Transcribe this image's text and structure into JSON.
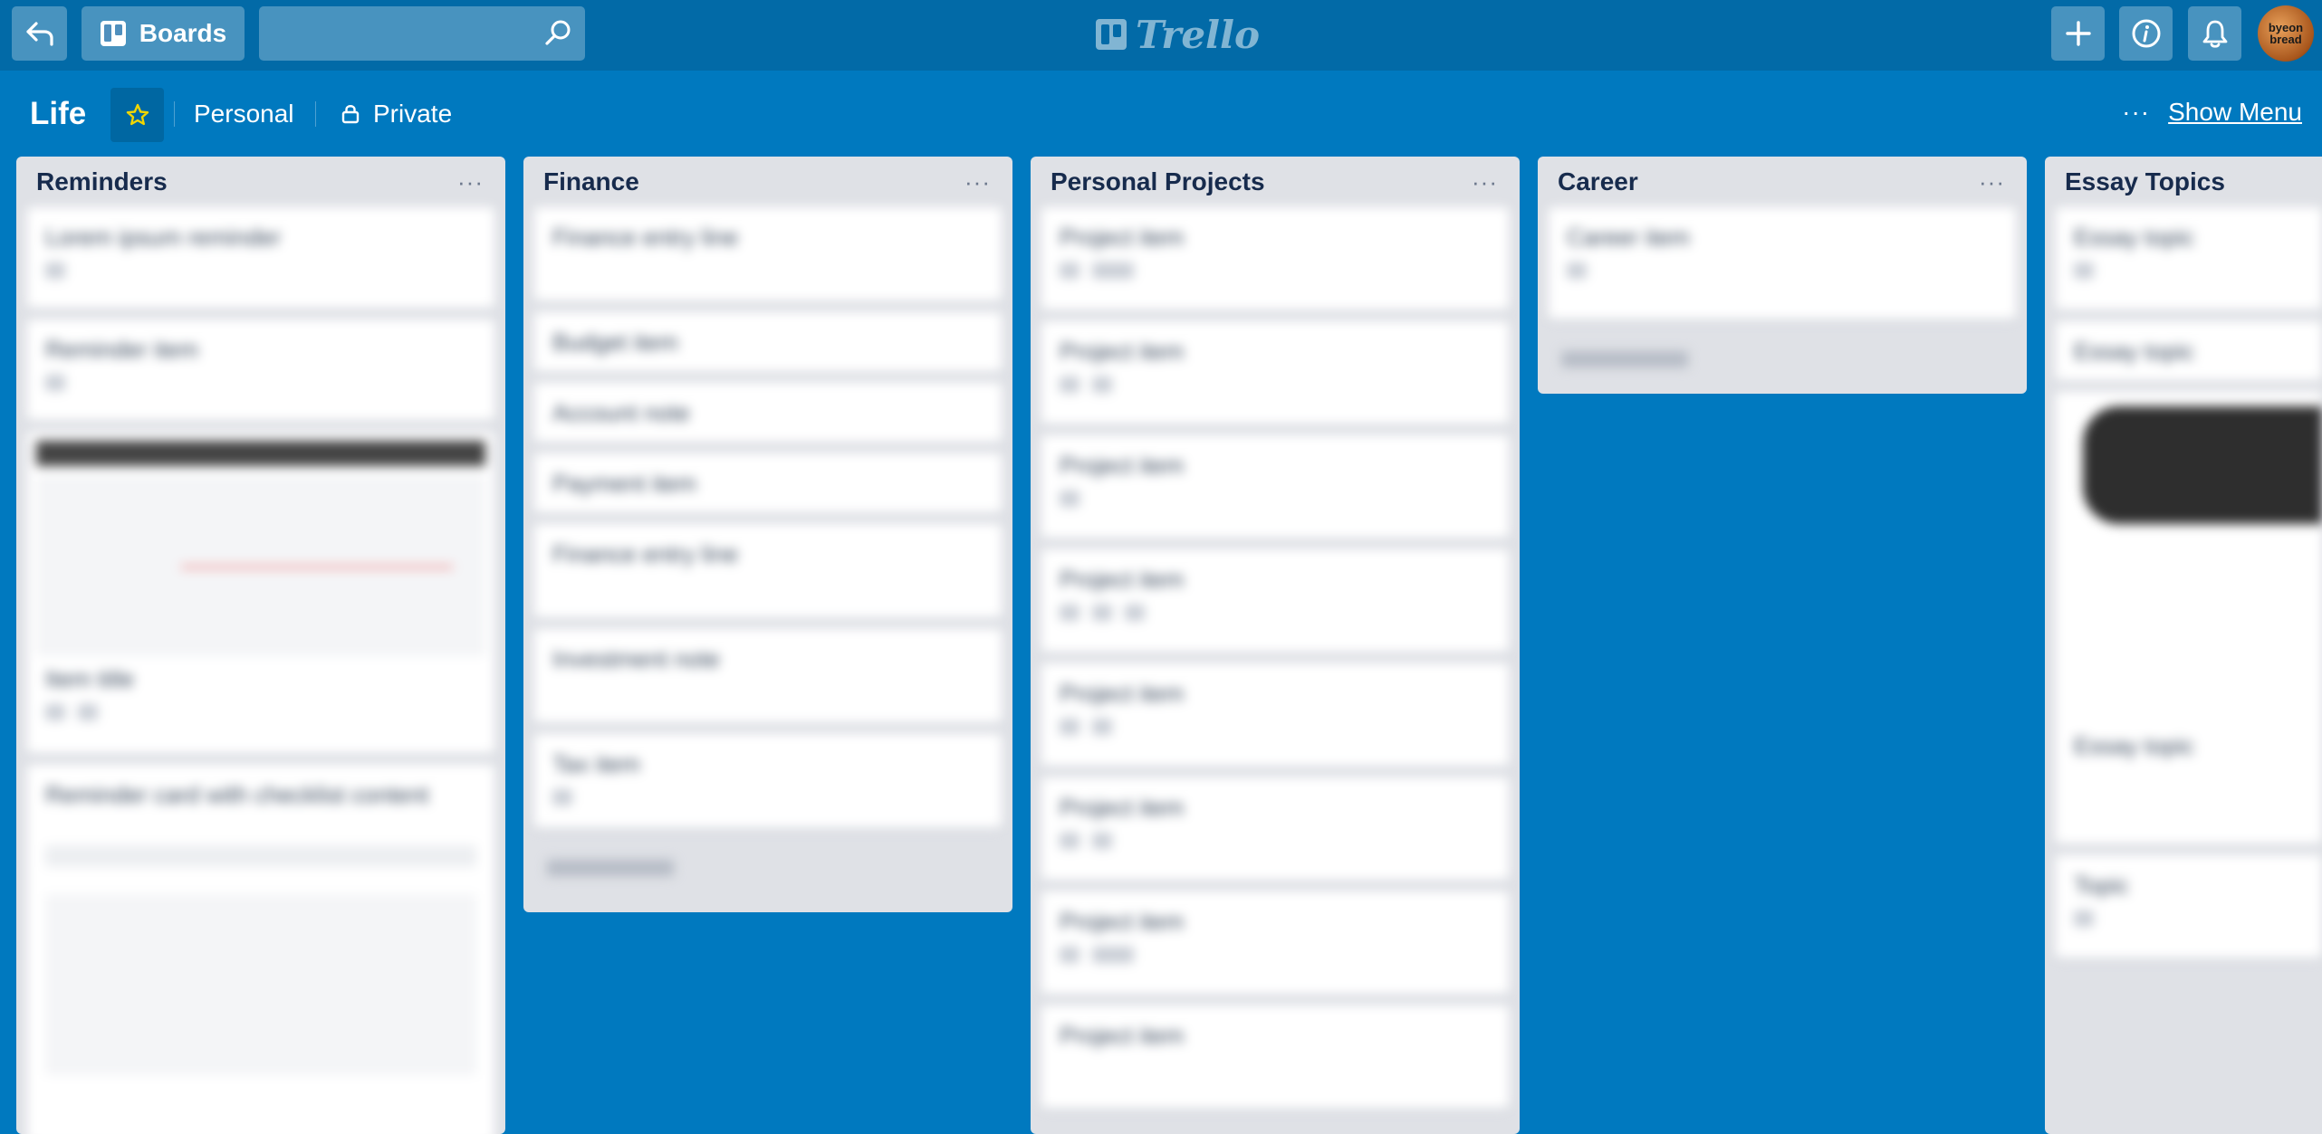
{
  "header": {
    "boards_label": "Boards",
    "logo_text": "Trello",
    "avatar_text_line1": "byeon",
    "avatar_text_line2": "bread"
  },
  "board": {
    "title": "Life",
    "team": "Personal",
    "visibility": "Private",
    "more_dots": "···",
    "show_menu": "Show Menu"
  },
  "lists": [
    {
      "title": "Reminders",
      "menu": "···"
    },
    {
      "title": "Finance",
      "menu": "···"
    },
    {
      "title": "Personal Projects",
      "menu": "···"
    },
    {
      "title": "Career",
      "menu": "···"
    },
    {
      "title": "Essay Topics",
      "menu": "···"
    }
  ],
  "colors": {
    "board_bg": "#0079bf",
    "header_bg": "#026aa7",
    "list_bg": "#dfe1e6",
    "label_green": "#61bd4f"
  }
}
